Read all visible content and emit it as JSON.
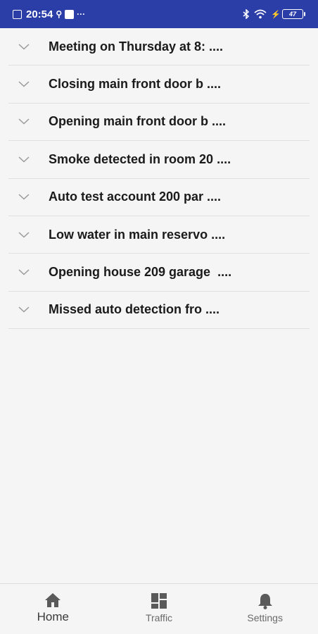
{
  "status_bar": {
    "time": "20:54",
    "extra": "···",
    "battery_level": "47",
    "bg_color": "#2b3ea8"
  },
  "notifications": [
    {
      "title": "Meeting on Thursday at 8: ...."
    },
    {
      "title": "Closing main front door b ...."
    },
    {
      "title": "Opening main front door b ...."
    },
    {
      "title": "Smoke detected in room 20 ...."
    },
    {
      "title": "Auto test account 200 par ...."
    },
    {
      "title": "Low water in main reservo ...."
    },
    {
      "title": "Opening house 209 garage  ...."
    },
    {
      "title": "Missed auto detection fro ...."
    }
  ],
  "bottom_nav": {
    "items": [
      {
        "label": "Home",
        "icon": "home-icon",
        "active": true
      },
      {
        "label": "Traffic",
        "icon": "dashboard-icon",
        "active": false
      },
      {
        "label": "Settings",
        "icon": "bell-icon",
        "active": false
      }
    ]
  }
}
